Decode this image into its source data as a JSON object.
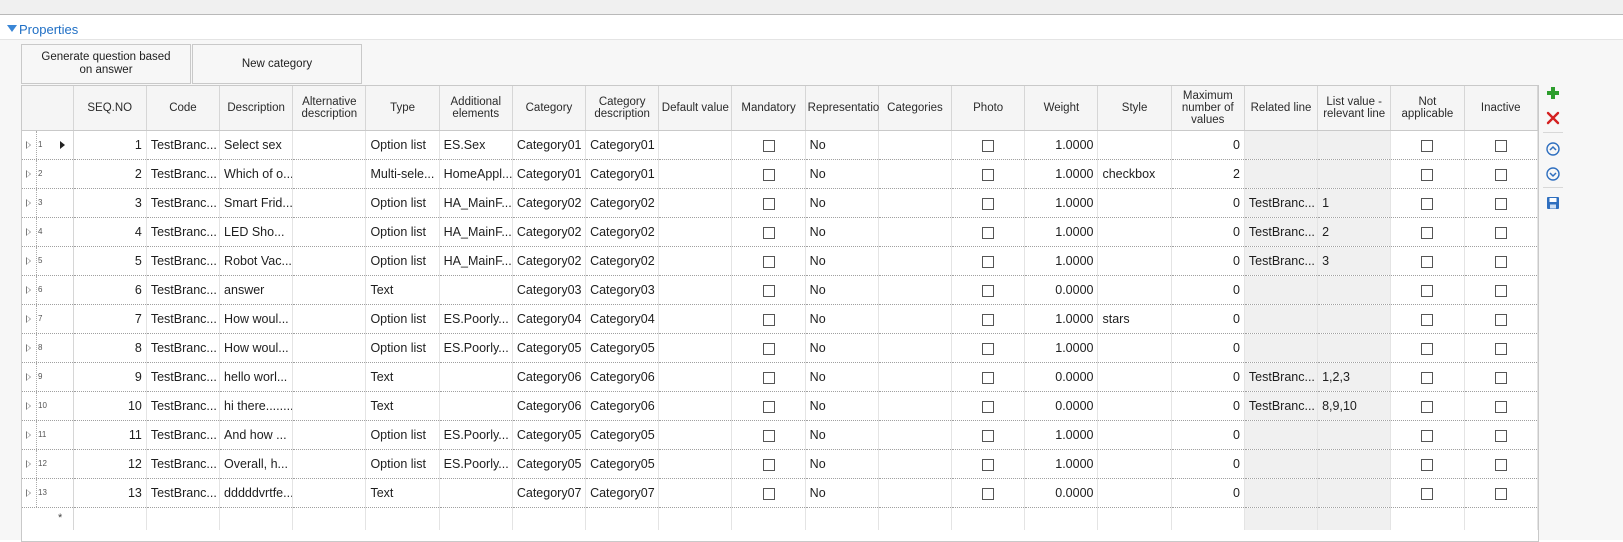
{
  "section": {
    "title": "Properties"
  },
  "toolbar": {
    "generate_label": "Generate question based on answer",
    "new_category_label": "New category"
  },
  "grid": {
    "columns": [
      "SEQ.NO",
      "Code",
      "Description",
      "Alternative description",
      "Type",
      "Additional elements",
      "Category",
      "Category description",
      "Default value",
      "Mandatory",
      "Representation",
      "Categories",
      "Photo",
      "Weight",
      "Style",
      "Maximum number of values",
      "Related line",
      "List value - relevant line",
      "Not applicable",
      "Inactive"
    ],
    "rows": [
      {
        "rn": "1",
        "seq": "1",
        "code": "TestBranc...",
        "desc": "Select sex",
        "alt": "",
        "type": "Option list",
        "add": "ES.Sex",
        "cat": "Category01",
        "catdesc": "Category01",
        "def": "",
        "rep": "No",
        "cats": "",
        "weight": "1.0000",
        "style": "",
        "max": "0",
        "rel": "",
        "listval": ""
      },
      {
        "rn": "2",
        "seq": "2",
        "code": "TestBranc...",
        "desc": "Which of o...",
        "alt": "",
        "type": "Multi-sele...",
        "add": "HomeAppl...",
        "cat": "Category01",
        "catdesc": "Category01",
        "def": "",
        "rep": "No",
        "cats": "",
        "weight": "1.0000",
        "style": "checkbox",
        "max": "2",
        "rel": "",
        "listval": ""
      },
      {
        "rn": "3",
        "seq": "3",
        "code": "TestBranc...",
        "desc": "Smart Frid...",
        "alt": "",
        "type": "Option list",
        "add": "HA_MainF...",
        "cat": "Category02",
        "catdesc": "Category02",
        "def": "",
        "rep": "No",
        "cats": "",
        "weight": "1.0000",
        "style": "",
        "max": "0",
        "rel": "TestBranc...",
        "listval": "1"
      },
      {
        "rn": "4",
        "seq": "4",
        "code": "TestBranc...",
        "desc": "LED Sho...",
        "alt": "",
        "type": "Option list",
        "add": "HA_MainF...",
        "cat": "Category02",
        "catdesc": "Category02",
        "def": "",
        "rep": "No",
        "cats": "",
        "weight": "1.0000",
        "style": "",
        "max": "0",
        "rel": "TestBranc...",
        "listval": "2"
      },
      {
        "rn": "5",
        "seq": "5",
        "code": "TestBranc...",
        "desc": "Robot Vac...",
        "alt": "",
        "type": "Option list",
        "add": "HA_MainF...",
        "cat": "Category02",
        "catdesc": "Category02",
        "def": "",
        "rep": "No",
        "cats": "",
        "weight": "1.0000",
        "style": "",
        "max": "0",
        "rel": "TestBranc...",
        "listval": "3"
      },
      {
        "rn": "6",
        "seq": "6",
        "code": "TestBranc...",
        "desc": "answer",
        "alt": "",
        "type": "Text",
        "add": "",
        "cat": "Category03",
        "catdesc": "Category03",
        "def": "",
        "rep": "No",
        "cats": "",
        "weight": "0.0000",
        "style": "",
        "max": "0",
        "rel": "",
        "listval": ""
      },
      {
        "rn": "7",
        "seq": "7",
        "code": "TestBranc...",
        "desc": "How woul...",
        "alt": "",
        "type": "Option list",
        "add": "ES.Poorly...",
        "cat": "Category04",
        "catdesc": "Category04",
        "def": "",
        "rep": "No",
        "cats": "",
        "weight": "1.0000",
        "style": "stars",
        "max": "0",
        "rel": "",
        "listval": ""
      },
      {
        "rn": "8",
        "seq": "8",
        "code": "TestBranc...",
        "desc": "How woul...",
        "alt": "",
        "type": "Option list",
        "add": "ES.Poorly...",
        "cat": "Category05",
        "catdesc": "Category05",
        "def": "",
        "rep": "No",
        "cats": "",
        "weight": "1.0000",
        "style": "",
        "max": "0",
        "rel": "",
        "listval": ""
      },
      {
        "rn": "9",
        "seq": "9",
        "code": "TestBranc...",
        "desc": "hello worl...",
        "alt": "",
        "type": "Text",
        "add": "",
        "cat": "Category06",
        "catdesc": "Category06",
        "def": "",
        "rep": "No",
        "cats": "",
        "weight": "0.0000",
        "style": "",
        "max": "0",
        "rel": "TestBranc...",
        "listval": "1,2,3"
      },
      {
        "rn": "10",
        "seq": "10",
        "code": "TestBranc...",
        "desc": "hi there........",
        "alt": "",
        "type": "Text",
        "add": "",
        "cat": "Category06",
        "catdesc": "Category06",
        "def": "",
        "rep": "No",
        "cats": "",
        "weight": "0.0000",
        "style": "",
        "max": "0",
        "rel": "TestBranc...",
        "listval": "8,9,10"
      },
      {
        "rn": "11",
        "seq": "11",
        "code": "TestBranc...",
        "desc": "And how ...",
        "alt": "",
        "type": "Option list",
        "add": "ES.Poorly...",
        "cat": "Category05",
        "catdesc": "Category05",
        "def": "",
        "rep": "No",
        "cats": "",
        "weight": "1.0000",
        "style": "",
        "max": "0",
        "rel": "",
        "listval": ""
      },
      {
        "rn": "12",
        "seq": "12",
        "code": "TestBranc...",
        "desc": "Overall, h...",
        "alt": "",
        "type": "Option list",
        "add": "ES.Poorly...",
        "cat": "Category05",
        "catdesc": "Category05",
        "def": "",
        "rep": "No",
        "cats": "",
        "weight": "1.0000",
        "style": "",
        "max": "0",
        "rel": "",
        "listval": ""
      },
      {
        "rn": "13",
        "seq": "13",
        "code": "TestBranc...",
        "desc": "dddddvrtfe...",
        "alt": "",
        "type": "Text",
        "add": "",
        "cat": "Category07",
        "catdesc": "Category07",
        "def": "",
        "rep": "No",
        "cats": "",
        "weight": "0.0000",
        "style": "",
        "max": "0",
        "rel": "",
        "listval": ""
      }
    ],
    "new_row_marker": "*"
  },
  "side_icons": [
    "add-icon",
    "delete-icon",
    "move-up-icon",
    "move-down-icon",
    "save-icon"
  ],
  "colors": {
    "accent": "#1f6fc5",
    "add": "#2e9e2e",
    "delete": "#d42020",
    "icon_blue": "#2f6fbf"
  }
}
